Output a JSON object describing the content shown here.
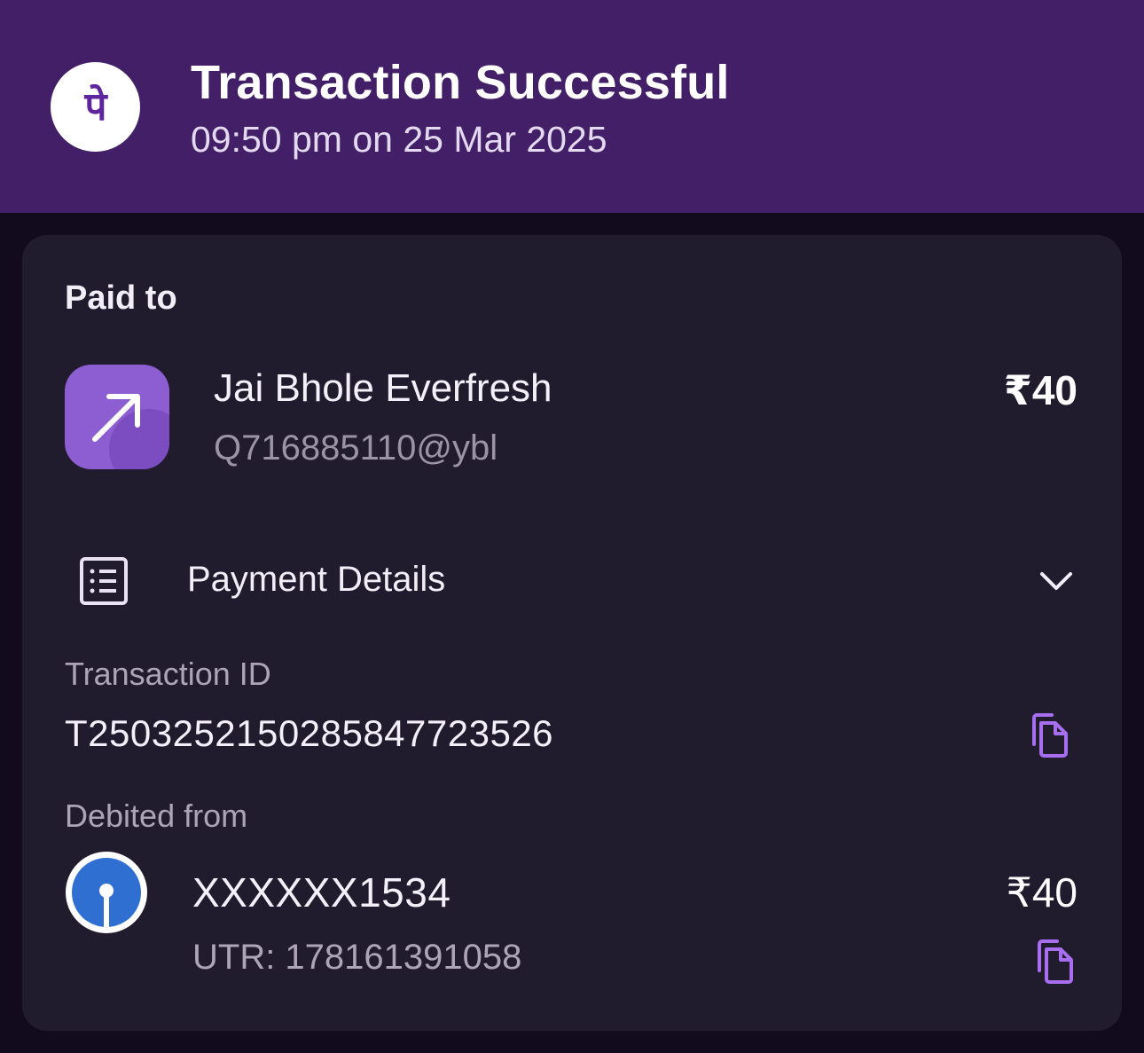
{
  "header": {
    "title": "Transaction Successful",
    "datetime": "09:50 pm on 25 Mar 2025",
    "logo_text": "पे",
    "background": "#421f66"
  },
  "paid_to": {
    "label": "Paid to",
    "name": "Jai Bhole Everfresh",
    "upi_id": "Q716885110@ybl",
    "amount": "₹40",
    "icon": "arrow-up-right-icon"
  },
  "payment_details": {
    "label": "Payment Details",
    "icon": "receipt-icon",
    "toggle_icon": "chevron-down-icon"
  },
  "transaction": {
    "id_label": "Transaction ID",
    "id_value": "T2503252150285847723526",
    "copy_icon": "copy-icon"
  },
  "debit": {
    "label": "Debited from",
    "account": "XXXXXX1534",
    "utr": "UTR: 178161391058",
    "amount": "₹40",
    "bank_icon": "bank-logo-icon",
    "copy_icon": "copy-icon"
  },
  "colors": {
    "accent": "#9b5fe6",
    "card_bg": "#211b2e",
    "page_bg": "#110b1d"
  }
}
